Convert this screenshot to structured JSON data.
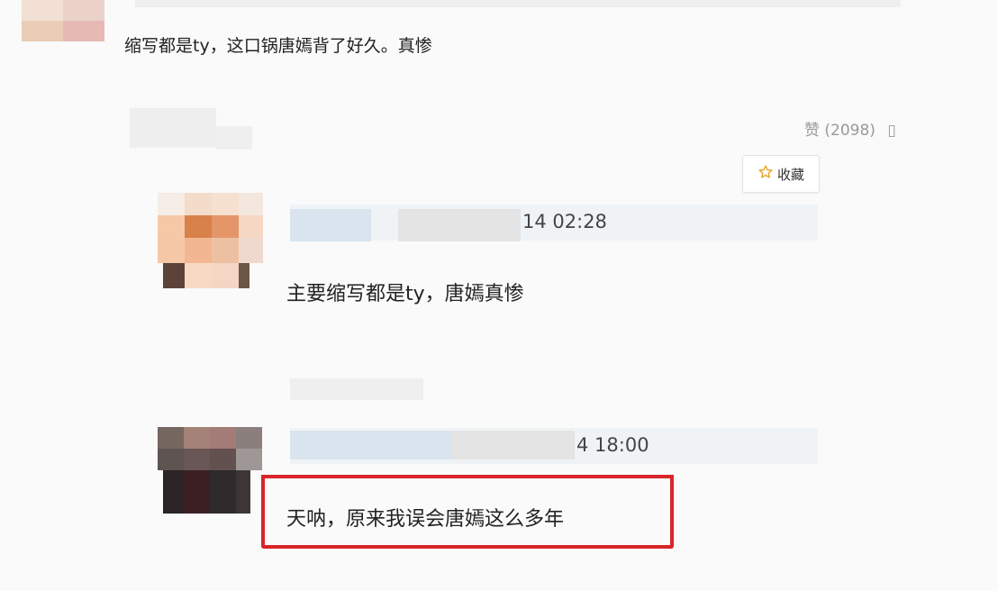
{
  "top_comment": {
    "text": "缩写都是ty，这口锅唐嫣背了好久。真惨"
  },
  "like": {
    "label": "赞",
    "count": "(2098)"
  },
  "favorite": {
    "label": "收藏",
    "icon": "star-icon"
  },
  "comments": [
    {
      "time": "14 02:28",
      "text": "主要缩写都是ty，唐嫣真惨"
    },
    {
      "time": "4 18:00",
      "text": "天呐，原来我误会唐嫣这么多年"
    }
  ],
  "colors": {
    "highlight": "#d8252a",
    "name_bar": "#f0f3f6"
  }
}
